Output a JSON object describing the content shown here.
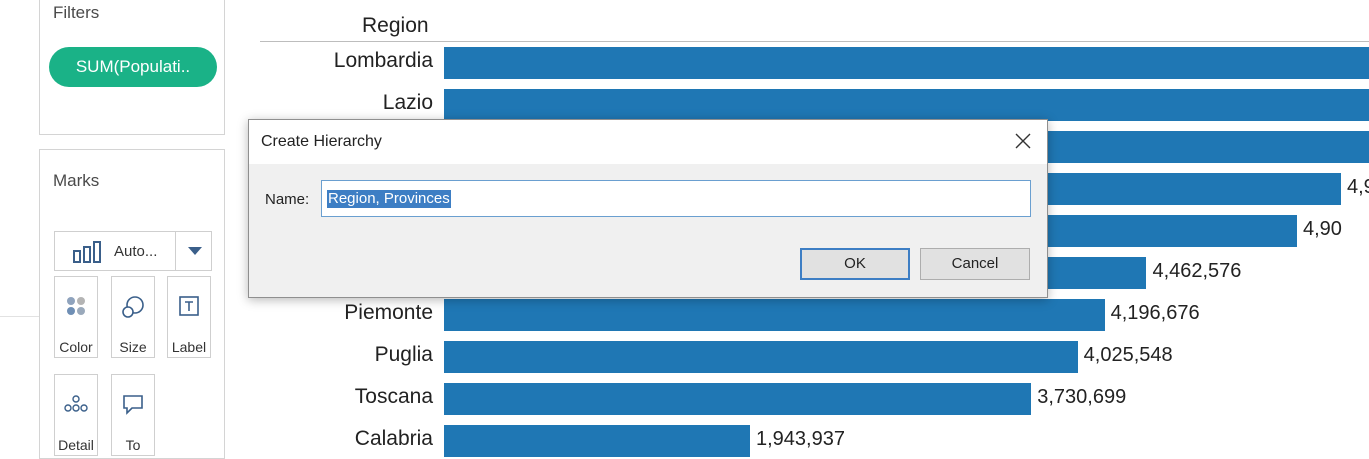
{
  "sidebar": {
    "filters": {
      "title": "Filters",
      "pill_label": "SUM(Populati.."
    },
    "marks": {
      "title": "Marks",
      "mark_type": "Auto...",
      "cards": [
        {
          "label": "Color",
          "icon": "color-dots-icon"
        },
        {
          "label": "Size",
          "icon": "size-circles-icon"
        },
        {
          "label": "Label",
          "icon": "label-text-icon"
        },
        {
          "label": "Detail",
          "icon": "detail-dots-icon"
        },
        {
          "label": "To",
          "icon": "tooltip-icon"
        }
      ]
    }
  },
  "view": {
    "column_header": "Region"
  },
  "chart_data": {
    "type": "bar",
    "orientation": "horizontal",
    "categories": [
      "Lombardia",
      "Lazio",
      "",
      "",
      "",
      "",
      "Piemonte",
      "Puglia",
      "Toscana",
      "Calabria"
    ],
    "values": [
      null,
      null,
      null,
      null,
      null,
      4462576,
      4196676,
      4025548,
      3730699,
      1943937
    ],
    "value_labels": [
      "",
      "",
      "",
      "4,9",
      "4,90",
      "4,462,576",
      "4,196,676",
      "4,025,548",
      "3,730,699",
      "1,943,937"
    ],
    "bar_color": "#1f77b4"
  },
  "dialog": {
    "title": "Create Hierarchy",
    "name_label": "Name:",
    "name_value": "Region, Provinces",
    "ok_label": "OK",
    "cancel_label": "Cancel"
  },
  "colors": {
    "pill": "#1ab287",
    "bar": "#1f77b4",
    "selection": "#3d7ec4"
  }
}
